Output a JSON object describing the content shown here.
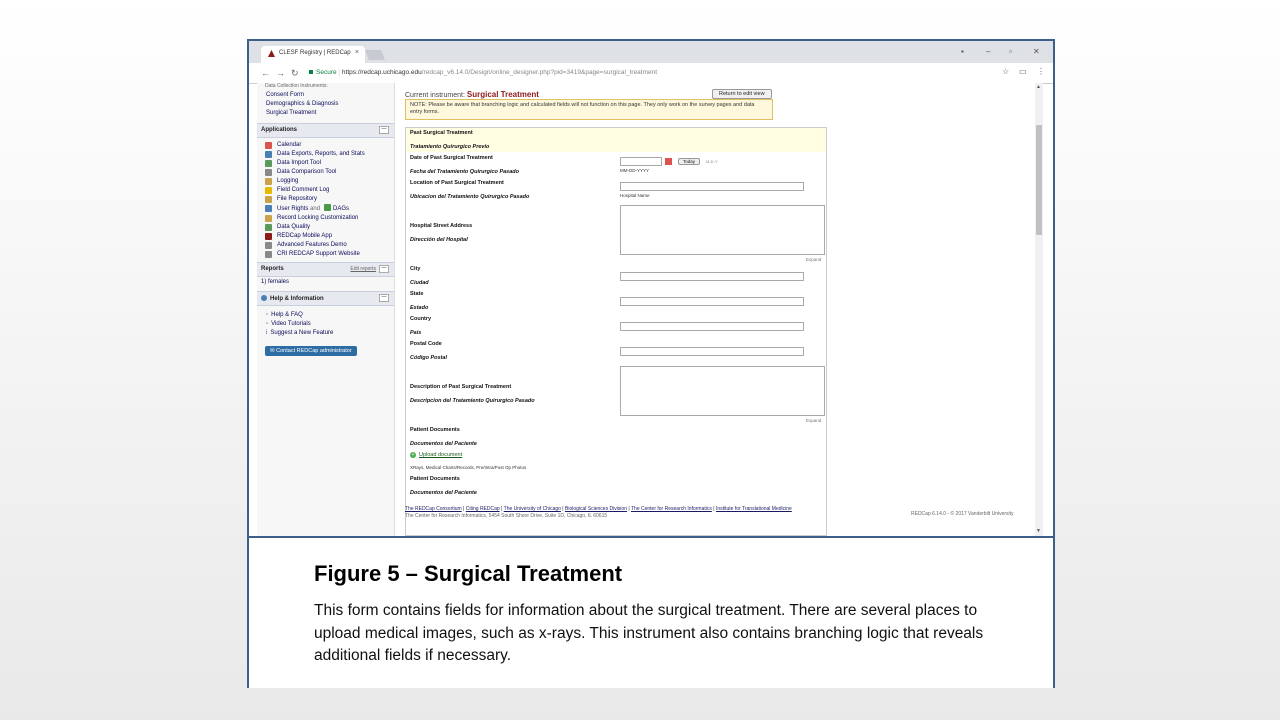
{
  "browser": {
    "tab_title": "CLESF Registry | REDCap",
    "tab_close": "×",
    "url_secure": "Secure",
    "url_host": "https://redcap.uchicago.edu",
    "url_path": "/redcap_v6.14.0/Design/online_designer.php?pid=3419&page=surgical_treatment"
  },
  "sidebar": {
    "instruments_label": "Data Collection Instruments:",
    "instruments": [
      "Consent Form",
      "Demographics & Diagnosis",
      "Surgical Treatment"
    ],
    "applications_header": "Applications",
    "applications": [
      {
        "label": "Calendar",
        "color": "#d9534f"
      },
      {
        "label": "Data Exports, Reports, and Stats",
        "color": "#4a7fb5"
      },
      {
        "label": "Data Import Tool",
        "color": "#5a9a5a"
      },
      {
        "label": "Data Comparison Tool",
        "color": "#888888"
      },
      {
        "label": "Logging",
        "color": "#c9a24a"
      },
      {
        "label": "Field Comment Log",
        "color": "#e6b800"
      },
      {
        "label": "File Repository",
        "color": "#c9a24a"
      },
      {
        "label": "User Rights",
        "color": "#4a7fb5"
      },
      {
        "label": "Record Locking Customization",
        "color": "#c9a24a"
      },
      {
        "label": "Data Quality",
        "color": "#5a9a5a"
      },
      {
        "label": "REDCap Mobile App",
        "color": "#8b1a1a"
      },
      {
        "label": "Advanced Features Demo",
        "color": "#888888"
      },
      {
        "label": "CRI REDCAP Support Website",
        "color": "#888888"
      }
    ],
    "user_rights_and": "and",
    "dags": "DAGs",
    "reports_header": "Reports",
    "edit_reports": "Edit reports",
    "report_item": "1) females",
    "help_header": "Help & Information",
    "help_items": [
      "Help & FAQ",
      "Video Tutorials",
      "Suggest a New Feature"
    ],
    "contact_button": "Contact REDCap administrator",
    "minimize": "—"
  },
  "main": {
    "current_instrument_label": "Current instrument:",
    "current_instrument": "Surgical Treatment",
    "return_button": "Return to edit view",
    "note": "NOTE: Please be aware that branching logic and calculated fields will not function on this page. They only work on the survey pages and data entry forms."
  },
  "form": {
    "section_en": "Past Surgical Treatment",
    "section_es": "Tratamiento Quirurgico Previo",
    "date_en": "Date of Past Surgical Treatment",
    "date_es": "Fecha del Tratamiento Quirurgico Pasado",
    "date_hint": "MM-DD-YYYY",
    "today": "Today",
    "ymd": "M-D-Y",
    "location_en": "Location of Past Surgical Treatment",
    "location_es": "Ubicacion del Tratamiento Quirurgico Pasado",
    "location_hint": "Hospital Name",
    "address_en": "Hospital Street Address",
    "address_es": "Dirección del Hospital",
    "expand": "Expand",
    "city_en": "City",
    "city_es": "Ciudad",
    "state_en": "State",
    "state_es": "Estado",
    "country_en": "Country",
    "country_es": "Pais",
    "postal_en": "Postal Code",
    "postal_es": "Código Postal",
    "desc_en": "Description of Past Surgical Treatment",
    "desc_es": "Descripcion del Tratamiento Quirurgico Pasado",
    "docs_en": "Patient Documents",
    "docs_es": "Documentos del Paciente",
    "upload": "Upload document",
    "upload_hint": "XRays, Medical Charts/Records, Pre/Intra/Post Op Photos",
    "docs2_en": "Patient Documents",
    "docs2_es": "Documentos del Paciente"
  },
  "footer": {
    "links": [
      "The REDCap Consortium",
      "Citing REDCap",
      "The University of Chicago",
      "Biological Sciences Division",
      "The Center for Research Informatics",
      "Institute for Translational Medicine"
    ],
    "address": "The Center for Research Informatics, 5454 South Shore Drive, Suite 1D, Chicago, IL 60615",
    "version": "REDCap 6.14.0 - © 2017 Vanderbilt University"
  },
  "caption": {
    "title": "Figure 5 – Surgical Treatment",
    "body": "This form contains fields for information about the surgical treatment. There are several places to upload medical images, such as x-rays.  This instrument also contains branching logic that reveals additional fields if necessary."
  }
}
